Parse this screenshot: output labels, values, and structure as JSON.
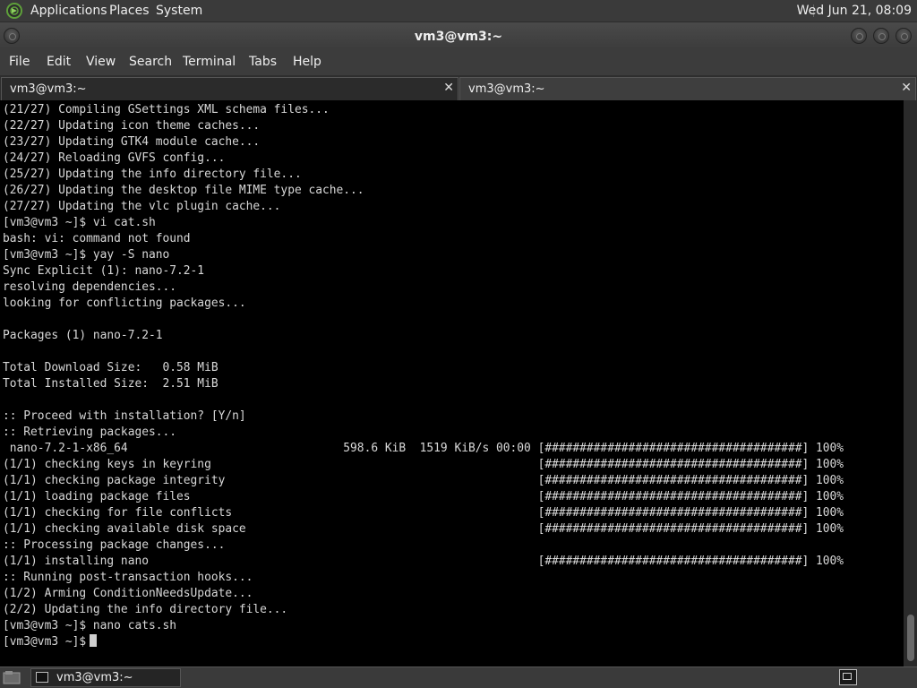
{
  "top_panel": {
    "menus": [
      "Applications",
      "Places",
      "System"
    ],
    "clock": "Wed Jun 21, 08:09"
  },
  "window": {
    "title": "vm3@vm3:~"
  },
  "menubar": {
    "items": [
      "File",
      "Edit",
      "View",
      "Search",
      "Terminal",
      "Tabs",
      "Help"
    ]
  },
  "tabs": [
    {
      "label": "vm3@vm3:~",
      "active": true
    },
    {
      "label": "vm3@vm3:~",
      "active": false
    }
  ],
  "terminal": {
    "lines": [
      "(21/27) Compiling GSettings XML schema files...",
      "(22/27) Updating icon theme caches...",
      "(23/27) Updating GTK4 module cache...",
      "(24/27) Reloading GVFS config...",
      "(25/27) Updating the info directory file...",
      "(26/27) Updating the desktop file MIME type cache...",
      "(27/27) Updating the vlc plugin cache...",
      "[vm3@vm3 ~]$ vi cat.sh",
      "bash: vi: command not found",
      "[vm3@vm3 ~]$ yay -S nano",
      "Sync Explicit (1): nano-7.2-1",
      "resolving dependencies...",
      "looking for conflicting packages...",
      "",
      "Packages (1) nano-7.2-1",
      "",
      "Total Download Size:   0.58 MiB",
      "Total Installed Size:  2.51 MiB",
      "",
      ":: Proceed with installation? [Y/n]",
      ":: Retrieving packages...",
      " nano-7.2-1-x86_64                               598.6 KiB  1519 KiB/s 00:00 [#####################################] 100%",
      "(1/1) checking keys in keyring                                               [#####################################] 100%",
      "(1/1) checking package integrity                                             [#####################################] 100%",
      "(1/1) loading package files                                                  [#####################################] 100%",
      "(1/1) checking for file conflicts                                            [#####################################] 100%",
      "(1/1) checking available disk space                                          [#####################################] 100%",
      ":: Processing package changes...",
      "(1/1) installing nano                                                        [#####################################] 100%",
      ":: Running post-transaction hooks...",
      "(1/2) Arming ConditionNeedsUpdate...",
      "(2/2) Updating the info directory file...",
      "[vm3@vm3 ~]$ nano cats.sh",
      "[vm3@vm3 ~]$"
    ]
  },
  "taskbar": {
    "task_label": "vm3@vm3:~"
  },
  "icons": {
    "logo": "distro-logo-icon",
    "show_desktop": "show-desktop-icon",
    "terminal": "terminal-icon",
    "workspace": "workspace-switcher-icon"
  },
  "colors": {
    "logo": "#5ea03a",
    "terminal_bg": "#000000",
    "terminal_fg": "#d8d8d8"
  }
}
